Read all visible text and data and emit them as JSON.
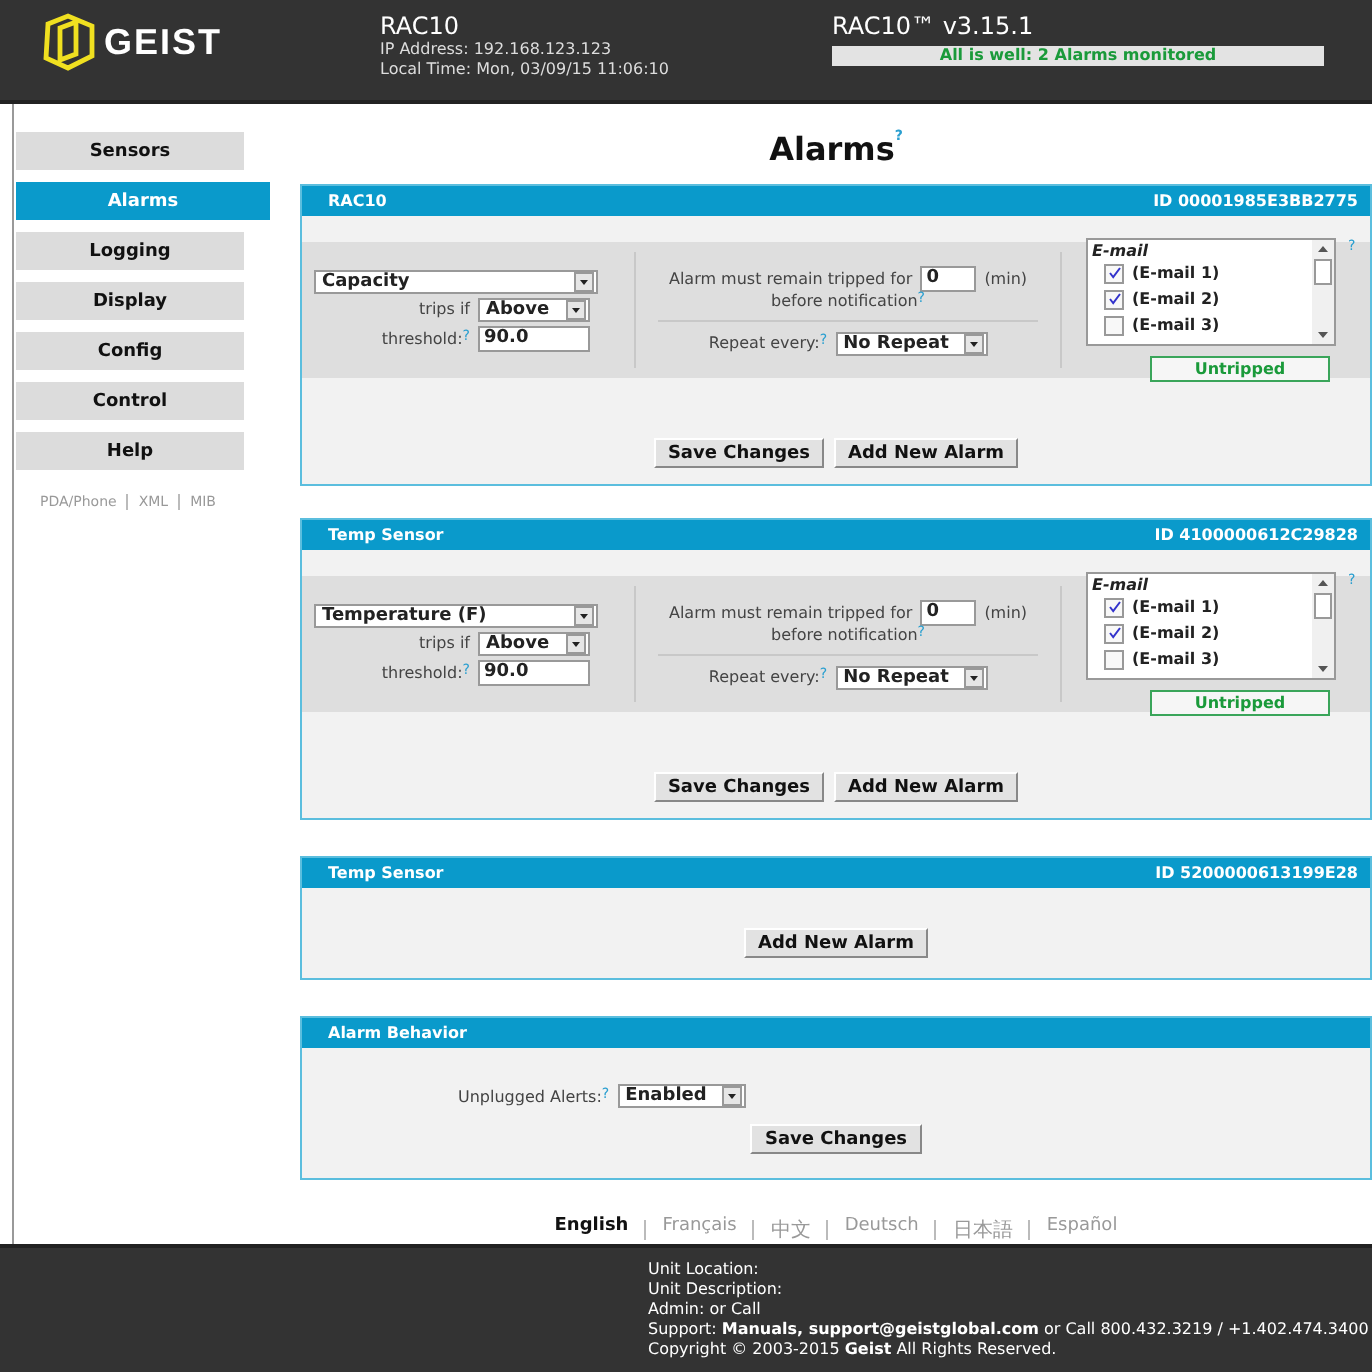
{
  "header": {
    "logo_text": "GEIST",
    "device_name": "RAC10",
    "ip": "IP Address: 192.168.123.123",
    "local_time": "Local Time: Mon, 03/09/15 11:06:10",
    "version": "RAC10™ v3.15.1",
    "status": "All is well: 2 Alarms monitored"
  },
  "nav": {
    "items": [
      {
        "label": "Sensors",
        "selected": false
      },
      {
        "label": "Alarms",
        "selected": true
      },
      {
        "label": "Logging",
        "selected": false
      },
      {
        "label": "Display",
        "selected": false
      },
      {
        "label": "Config",
        "selected": false
      },
      {
        "label": "Control",
        "selected": false
      },
      {
        "label": "Help",
        "selected": false
      }
    ],
    "links": [
      "PDA/Phone",
      "XML",
      "MIB"
    ]
  },
  "page_title": "Alarms$^{?}$",
  "sensors": [
    {
      "name": "RAC10",
      "id": "ID 00001985E3BB2775",
      "alarms": [
        {
          "measure": "Capacity",
          "trips_label": "trips if",
          "trips_if": "Above",
          "threshold_label": "threshold:$^{?}$",
          "threshold": "90.0",
          "delay_label": "Alarm must remain tripped for",
          "delay": "0",
          "delay_unit": "(min)",
          "notify_label": "before notification$^{?}$",
          "repeat_label": "Repeat every:$^{?}$",
          "repeat": "No Repeat",
          "list_title": "E-mail",
          "help": "?",
          "recipients": [
            {
              "label": "(E-mail 1)",
              "checked": true
            },
            {
              "label": "(E-mail 2)",
              "checked": true
            },
            {
              "label": "(E-mail 3)",
              "checked": false
            }
          ],
          "state": "Untripped"
        }
      ],
      "buttons": [
        "Save Changes",
        "Add New Alarm"
      ]
    },
    {
      "name": "Temp Sensor",
      "id": "ID 4100000612C29828",
      "alarms": [
        {
          "measure": "Temperature (F)",
          "trips_label": "trips if",
          "trips_if": "Above",
          "threshold_label": "threshold:$^{?}$",
          "threshold": "90.0",
          "delay_label": "Alarm must remain tripped for",
          "delay": "0",
          "delay_unit": "(min)",
          "notify_label": "before notification$^{?}$",
          "repeat_label": "Repeat every:$^{?}$",
          "repeat": "No Repeat",
          "list_title": "E-mail",
          "help": "?",
          "recipients": [
            {
              "label": "(E-mail 1)",
              "checked": true
            },
            {
              "label": "(E-mail 2)",
              "checked": true
            },
            {
              "label": "(E-mail 3)",
              "checked": false
            }
          ],
          "state": "Untripped"
        }
      ],
      "buttons": [
        "Save Changes",
        "Add New Alarm"
      ]
    },
    {
      "name": "Temp Sensor",
      "id": "ID 5200000613199E28",
      "buttons": [
        "Add New Alarm"
      ]
    }
  ],
  "alarm_behavior": {
    "title": "Alarm Behavior",
    "label": "Unplugged Alerts:$^{?}$",
    "value": "Enabled",
    "button": "Save Changes"
  },
  "languages": [
    {
      "label": "English",
      "selected": true
    },
    {
      "label": "Français",
      "selected": false
    },
    {
      "label": "中文",
      "selected": false
    },
    {
      "label": "Deutsch",
      "selected": false
    },
    {
      "label": "日本語",
      "selected": false
    },
    {
      "label": "Español",
      "selected": false
    }
  ],
  "footer": [
    "Unit Location:",
    "Unit Description:",
    "Admin: or Call",
    "Support: **Manuals, support@geistglobal.com** or Call 800.432.3219 / +1.402.474.3400",
    "Copyright © 2003-2015 **Geist** All Rights Reserved."
  ]
}
